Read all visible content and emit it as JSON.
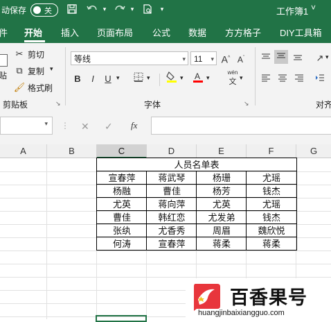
{
  "titlebar": {
    "autosave_label": "动保存",
    "toggle_label": "关",
    "doc_title": "工作簿1",
    "chevron": "˅"
  },
  "tabs": [
    {
      "label": "件"
    },
    {
      "label": "开始",
      "active": true
    },
    {
      "label": "插入"
    },
    {
      "label": "页面布局"
    },
    {
      "label": "公式"
    },
    {
      "label": "数据"
    },
    {
      "label": "方方格子"
    },
    {
      "label": "DIY工具箱"
    }
  ],
  "ribbon": {
    "clipboard": {
      "cut": "剪切",
      "copy": "复制",
      "format_painter": "格式刷",
      "paste_partial": "贴",
      "group_label": "剪贴板"
    },
    "font": {
      "name": "等线",
      "size": "11",
      "grow": "A",
      "shrink": "A",
      "bold": "B",
      "italic": "I",
      "underline": "U",
      "phonetic_top": "wén",
      "phonetic_bottom": "文",
      "group_label": "字体",
      "fill_color": "#ffff00",
      "font_color": "#ff0000"
    },
    "alignment": {
      "group_label_partial": "对齐"
    }
  },
  "formula_bar": {
    "cancel": "✕",
    "enter": "✓",
    "fx": "fx",
    "value": ""
  },
  "grid": {
    "columns": [
      "A",
      "B",
      "C",
      "D",
      "E",
      "F",
      "G"
    ],
    "selected_column": "C",
    "table_title": "人员名单表",
    "rows": [
      [
        "宣春萍",
        "蒋武琴",
        "杨珊",
        "尤瑶"
      ],
      [
        "杨融",
        "曹佳",
        "杨芳",
        "钱杰"
      ],
      [
        "尤英",
        "蒋向萍",
        "尤英",
        "尤瑶"
      ],
      [
        "曹佳",
        "韩红恋",
        "尤发弟",
        "钱杰"
      ],
      [
        "张纨",
        "尤香秀",
        "周眉",
        "魏欣悦"
      ],
      [
        "何涛",
        "宣春萍",
        "蒋柔",
        "蒋柔"
      ]
    ]
  },
  "watermark": {
    "brand": "百香果号",
    "url": "huangjinbaixiangguo.com",
    "logo_color": "#e8363c"
  }
}
